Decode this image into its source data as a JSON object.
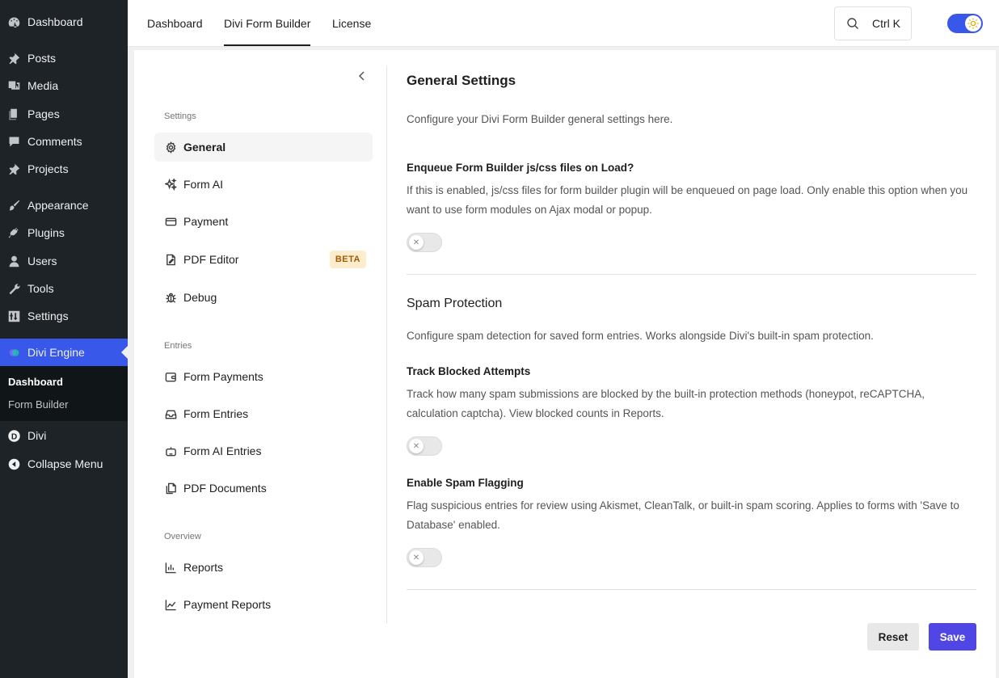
{
  "wp_menu": {
    "items": [
      {
        "label": "Dashboard",
        "icon": "dashboard-icon"
      },
      {
        "label": "Posts",
        "icon": "pin-icon"
      },
      {
        "label": "Media",
        "icon": "media-icon"
      },
      {
        "label": "Pages",
        "icon": "pages-icon"
      },
      {
        "label": "Comments",
        "icon": "comment-icon"
      },
      {
        "label": "Projects",
        "icon": "pin-icon"
      },
      {
        "label": "Appearance",
        "icon": "brush-icon"
      },
      {
        "label": "Plugins",
        "icon": "plug-icon"
      },
      {
        "label": "Users",
        "icon": "user-icon"
      },
      {
        "label": "Tools",
        "icon": "wrench-icon"
      },
      {
        "label": "Settings",
        "icon": "sliders-icon"
      },
      {
        "label": "Divi Engine",
        "icon": "divi-engine-icon"
      },
      {
        "label": "Divi",
        "icon": "divi-icon"
      },
      {
        "label": "Collapse Menu",
        "icon": "collapse-icon"
      }
    ],
    "submenu": [
      "Dashboard",
      "Form Builder"
    ],
    "active_color": "#3858e9"
  },
  "topbar": {
    "tabs": [
      "Dashboard",
      "Divi Form Builder",
      "License"
    ],
    "active_tab": "Divi Form Builder",
    "search_shortcut": "Ctrl K"
  },
  "nav": {
    "groups": {
      "settings": "Settings",
      "entries": "Entries",
      "overview": "Overview"
    },
    "settings_items": [
      "General",
      "Form AI",
      "Payment",
      "PDF Editor",
      "Debug"
    ],
    "beta_badge": "BETA",
    "entries_items": [
      "Form Payments",
      "Form Entries",
      "Form AI Entries",
      "PDF Documents"
    ],
    "overview_items": [
      "Reports",
      "Payment Reports"
    ]
  },
  "main": {
    "title": "General Settings",
    "intro": "Configure your Divi Form Builder general settings here.",
    "enqueue": {
      "label": "Enqueue Form Builder js/css files on Load?",
      "desc": "If this is enabled, js/css files for form builder plugin will be enqueued on page load. Only enable this option when you want to use form modules on Ajax modal or popup.",
      "enabled": false
    },
    "spam": {
      "title": "Spam Protection",
      "desc": "Configure spam detection for saved form entries. Works alongside Divi's built-in spam protection.",
      "track": {
        "label": "Track Blocked Attempts",
        "desc": "Track how many spam submissions are blocked by the built-in protection methods (honeypot, reCAPTCHA, calculation captcha). View blocked counts in Reports.",
        "enabled": false
      },
      "flagging": {
        "label": "Enable Spam Flagging",
        "desc": "Flag suspicious entries for review using Akismet, CleanTalk, or built-in spam scoring. Applies to forms with 'Save to Database' enabled.",
        "enabled": false
      }
    },
    "reset_label": "Reset",
    "save_label": "Save",
    "accent": "#4f46e5"
  }
}
